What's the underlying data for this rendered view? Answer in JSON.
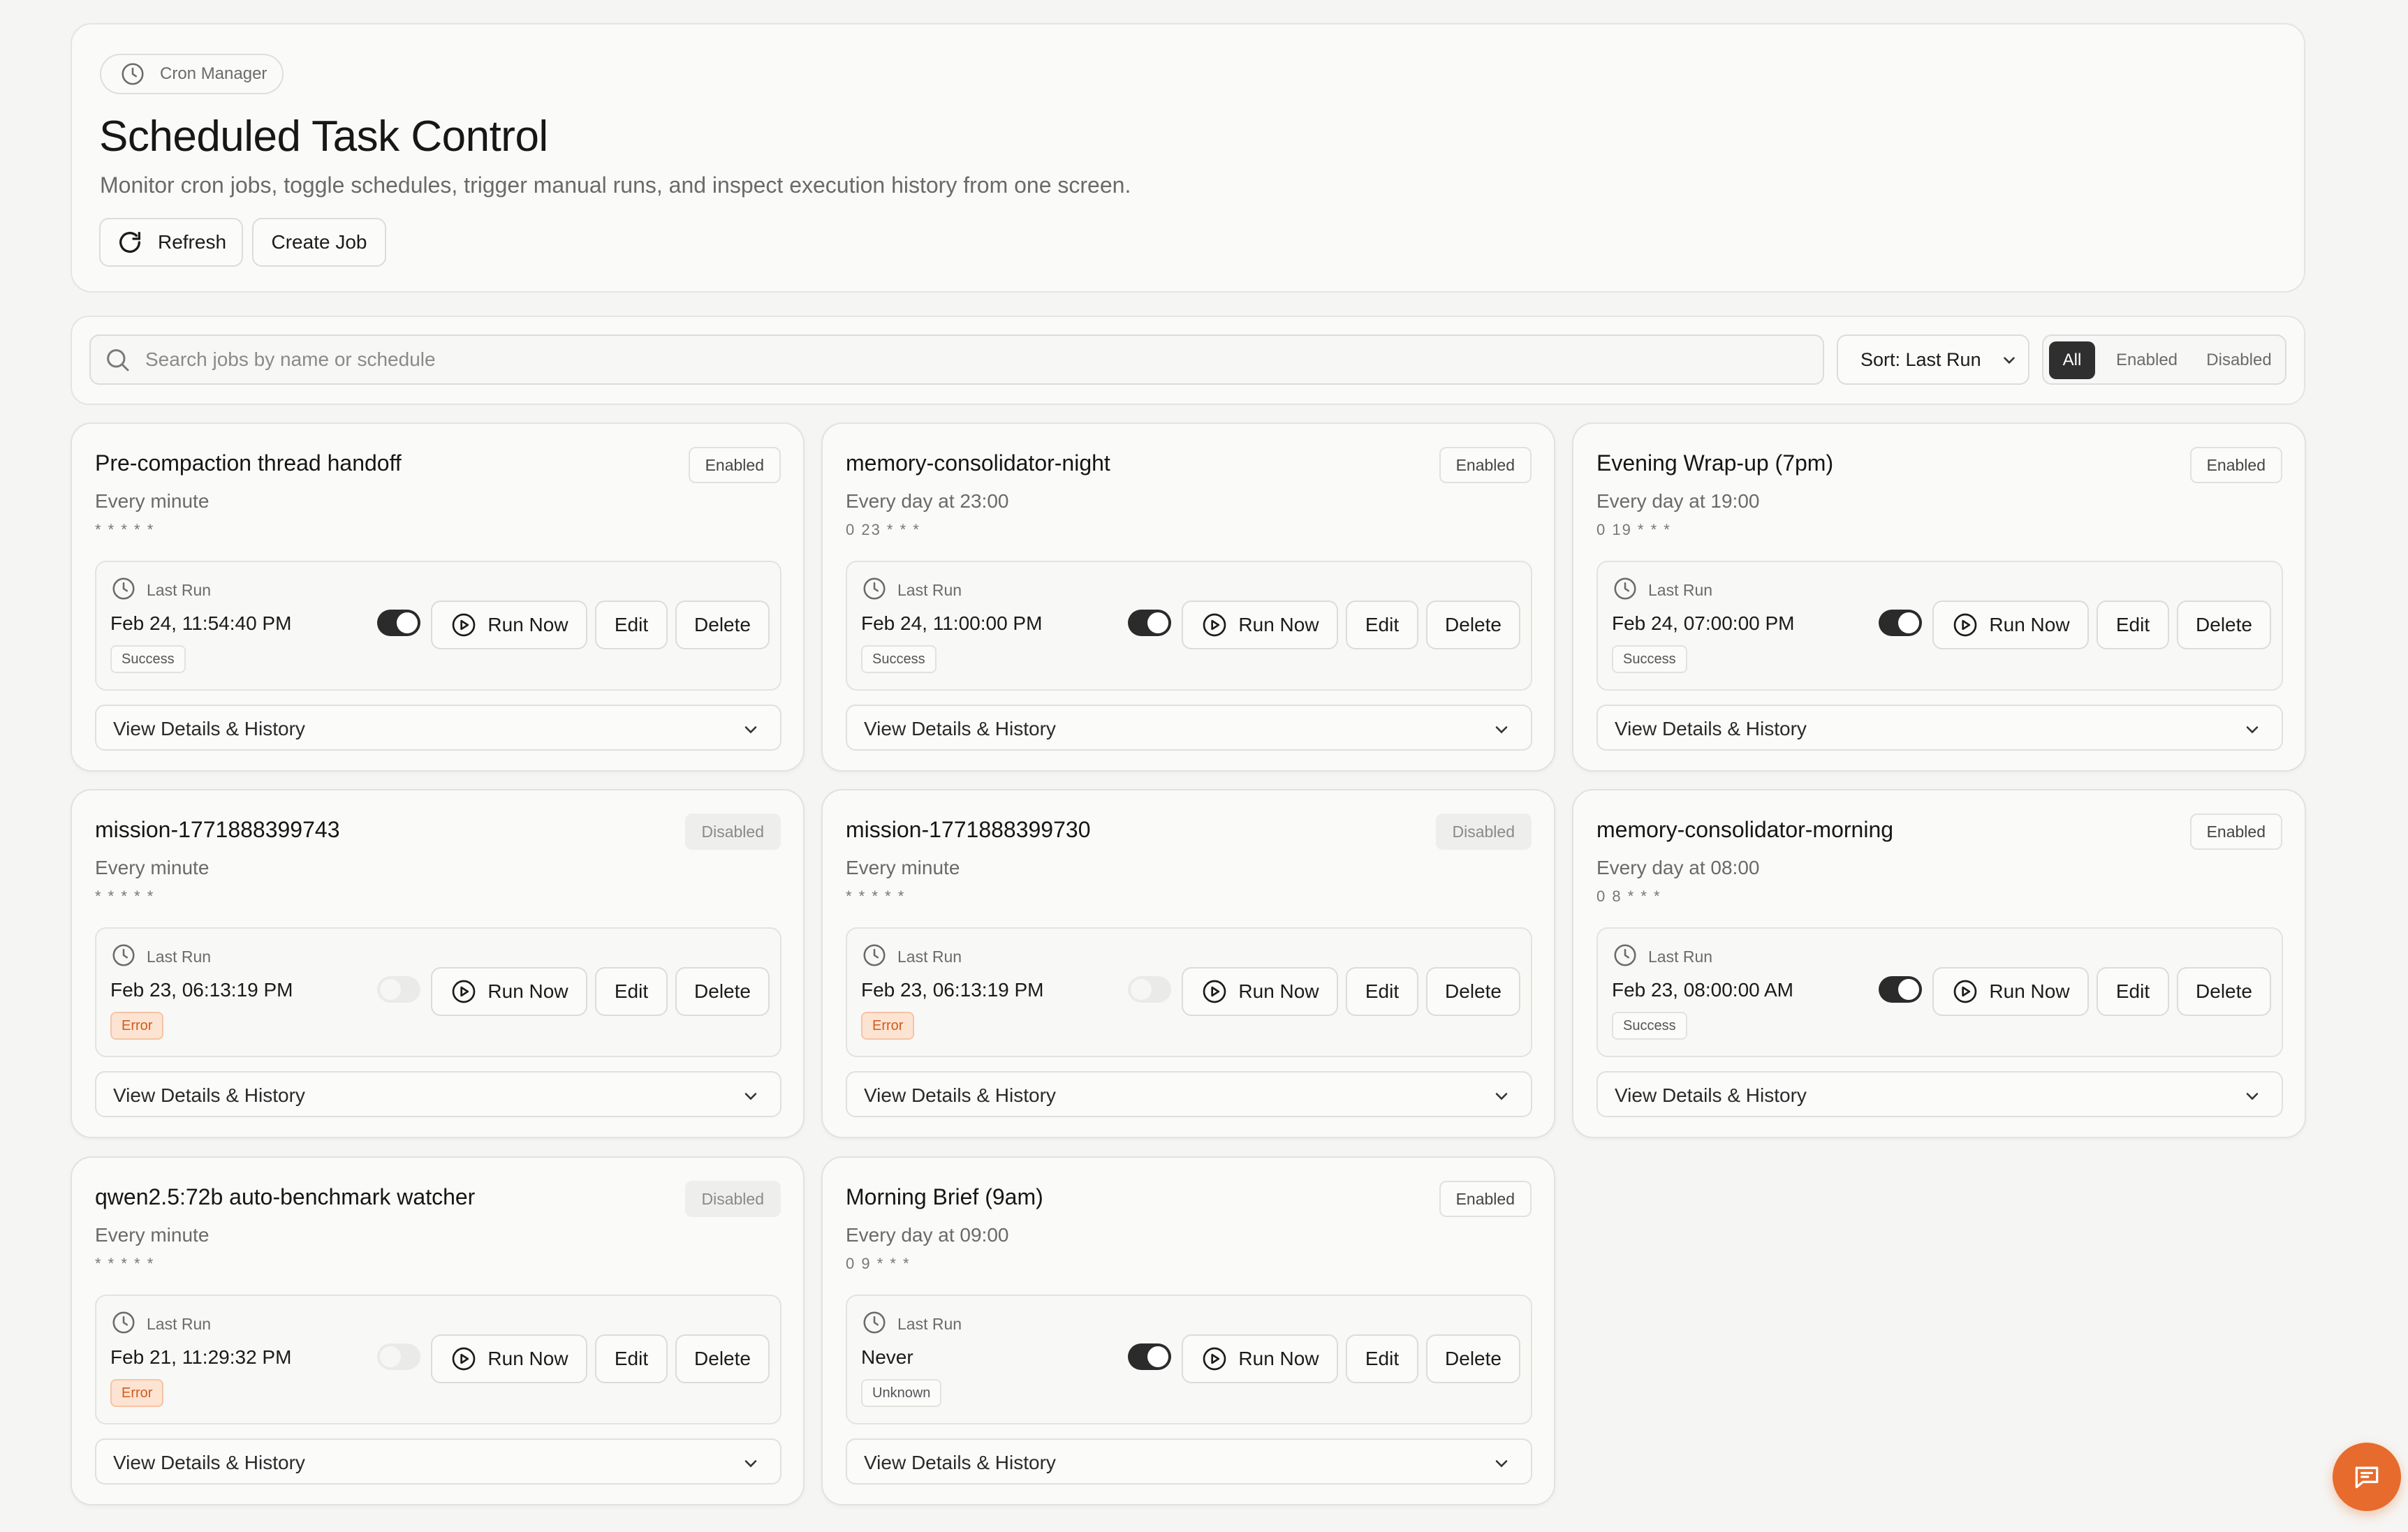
{
  "header": {
    "chip_label": "Cron Manager",
    "title": "Scheduled Task Control",
    "subtitle": "Monitor cron jobs, toggle schedules, trigger manual runs, and inspect execution history from one screen.",
    "refresh_label": "Refresh",
    "create_label": "Create Job"
  },
  "toolbar": {
    "search_placeholder": "Search jobs by name or schedule",
    "search_value": "",
    "sort_label": "Sort: Last Run",
    "filters": [
      "All",
      "Enabled",
      "Disabled"
    ],
    "active_filter": "All"
  },
  "labels": {
    "last_run": "Last Run",
    "run_now": "Run Now",
    "edit": "Edit",
    "delete": "Delete",
    "details": "View Details & History"
  },
  "colors": {
    "accent": "#e76b2c",
    "toggle_on": "#2b2b2b",
    "error_bg": "#fde3d2",
    "error_text": "#d35a1c"
  },
  "icons": {
    "chip": "clock-icon",
    "refresh": "refresh-icon",
    "search": "search-icon",
    "sort": "chevron-down-icon",
    "last_run": "clock-icon",
    "run_now": "play-circle-icon",
    "details": "chevron-down-icon",
    "fab": "chat-icon"
  },
  "jobs": [
    {
      "name": "Pre-compaction thread handoff",
      "status": "Enabled",
      "description": "Every minute",
      "cron": "* * * * *",
      "last_run": "Feb 24, 11:54:40 PM",
      "result": "Success",
      "enabled": true
    },
    {
      "name": "memory-consolidator-night",
      "status": "Enabled",
      "description": "Every day at 23:00",
      "cron": "0 23 * * *",
      "last_run": "Feb 24, 11:00:00 PM",
      "result": "Success",
      "enabled": true
    },
    {
      "name": "Evening Wrap-up (7pm)",
      "status": "Enabled",
      "description": "Every day at 19:00",
      "cron": "0 19 * * *",
      "last_run": "Feb 24, 07:00:00 PM",
      "result": "Success",
      "enabled": true
    },
    {
      "name": "mission-1771888399743",
      "status": "Disabled",
      "description": "Every minute",
      "cron": "* * * * *",
      "last_run": "Feb 23, 06:13:19 PM",
      "result": "Error",
      "enabled": false
    },
    {
      "name": "mission-1771888399730",
      "status": "Disabled",
      "description": "Every minute",
      "cron": "* * * * *",
      "last_run": "Feb 23, 06:13:19 PM",
      "result": "Error",
      "enabled": false
    },
    {
      "name": "memory-consolidator-morning",
      "status": "Enabled",
      "description": "Every day at 08:00",
      "cron": "0 8 * * *",
      "last_run": "Feb 23, 08:00:00 AM",
      "result": "Success",
      "enabled": true
    },
    {
      "name": "qwen2.5:72b auto-benchmark watcher",
      "status": "Disabled",
      "description": "Every minute",
      "cron": "* * * * *",
      "last_run": "Feb 21, 11:29:32 PM",
      "result": "Error",
      "enabled": false
    },
    {
      "name": "Morning Brief (9am)",
      "status": "Enabled",
      "description": "Every day at 09:00",
      "cron": "0 9 * * *",
      "last_run": "Never",
      "result": "Unknown",
      "enabled": true
    }
  ]
}
